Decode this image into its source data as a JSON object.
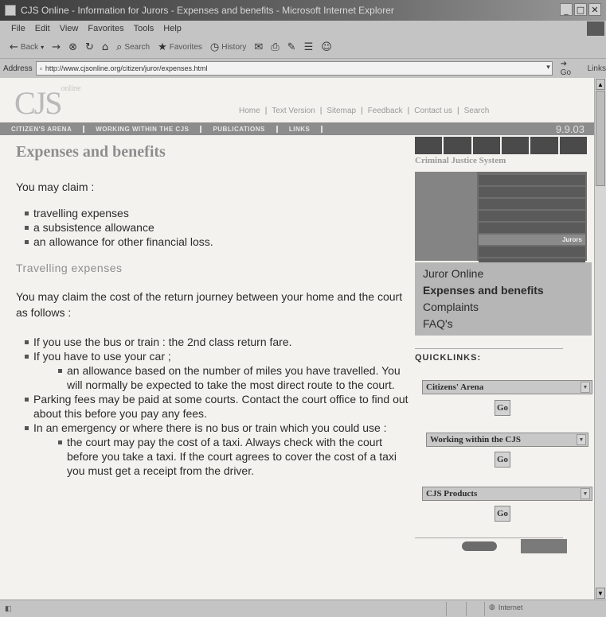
{
  "window": {
    "title": "CJS Online - Information for Jurors - Expenses and benefits - Microsoft Internet Explorer",
    "controls": [
      "_",
      "□",
      "✕"
    ]
  },
  "menubar": [
    "File",
    "Edit",
    "View",
    "Favorites",
    "Tools",
    "Help"
  ],
  "toolbar": {
    "back_label": "Back",
    "search_label": "Search",
    "favorites_label": "Favorites",
    "history_label": "History"
  },
  "addressbar": {
    "label": "Address",
    "url": "http://www.cjsonline.org/citizen/juror/expenses.html",
    "go_label": "Go",
    "links_label": "Links"
  },
  "site": {
    "logo_main": "CJS",
    "logo_sub": "online",
    "top_links": [
      "Home",
      "Text Version",
      "Sitemap",
      "Feedback",
      "Contact us",
      "Search"
    ],
    "nav": [
      "CITIZEN'S ARENA",
      "WORKING WITHIN THE CJS",
      "PUBLICATIONS",
      "LINKS"
    ],
    "date": "9.9.03",
    "banner_text": "Criminal Justice System",
    "image_bands": [
      "",
      "",
      "",
      "",
      "",
      "Jurors",
      "",
      ""
    ]
  },
  "content": {
    "title": "Expenses and benefits",
    "intro": "You may claim :",
    "claims": [
      "travelling expenses",
      "a subsistence allowance",
      "an allowance for other financial loss."
    ],
    "travel_heading": "Travelling expenses",
    "travel_intro": "You may claim the cost of the return journey between your home and the court as follows :",
    "bus": "If you use the bus or train : the 2nd class return fare.",
    "car": "If you have to use your car ;",
    "car_sub": "an allowance based on the number of miles you have travelled. You will normally be expected to take the most direct route to the court.",
    "parking": "Parking fees may be paid at some courts. Contact the court office to find out about this before you pay any fees.",
    "emergency": "In an emergency or where there is no bus or train which you could use :",
    "emergency_sub": "the court may pay the cost of a taxi. Always check with the court before you take a taxi. If the court agrees to cover the cost of a taxi you must get a receipt from the driver."
  },
  "sidebar": {
    "menu": [
      "Juror Online",
      "Expenses and benefits",
      "Complaints",
      "FAQ's"
    ],
    "quicklinks_label": "QUICKLINKS:",
    "selects": [
      "Citizens' Arena",
      "Working within the CJS",
      "CJS Products"
    ],
    "go_label": "Go"
  },
  "statusbar": {
    "zone": "Internet"
  }
}
